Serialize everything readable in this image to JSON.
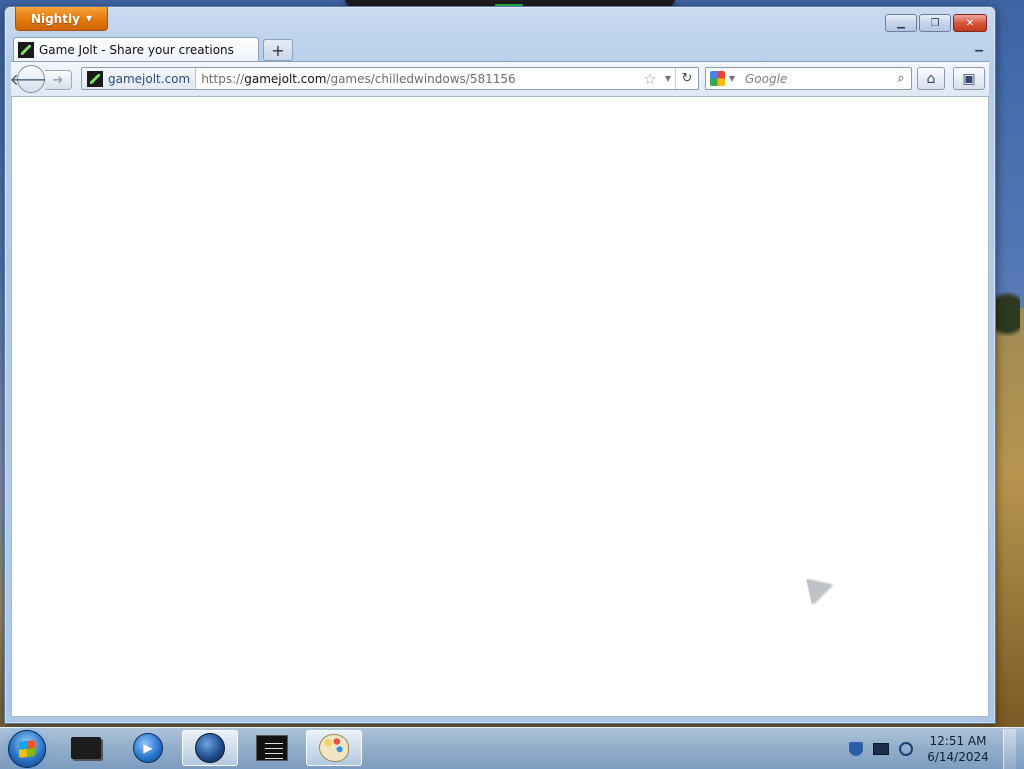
{
  "browser": {
    "app_button": "Nightly",
    "tab": {
      "title": "Game Jolt - Share your creations"
    },
    "new_tab_symbol": "+",
    "identity_site": "gamejolt.com",
    "url": {
      "scheme": "https://",
      "host": "gamejolt.com",
      "path": "/games/chilledwindows/581156"
    },
    "search": {
      "placeholder": "Google"
    }
  },
  "taskbar": {
    "apps": [
      "folder",
      "media-player",
      "browser-globe",
      "terminal",
      "paint"
    ],
    "active_app": "browser-globe",
    "clock": {
      "time": "12:51 AM",
      "date": "6/14/2024"
    }
  },
  "colors": {
    "app_button": "#e3780e",
    "window_frame": "#b7cde9",
    "close_button": "#d6553b",
    "taskbar": "#94b4d7"
  }
}
